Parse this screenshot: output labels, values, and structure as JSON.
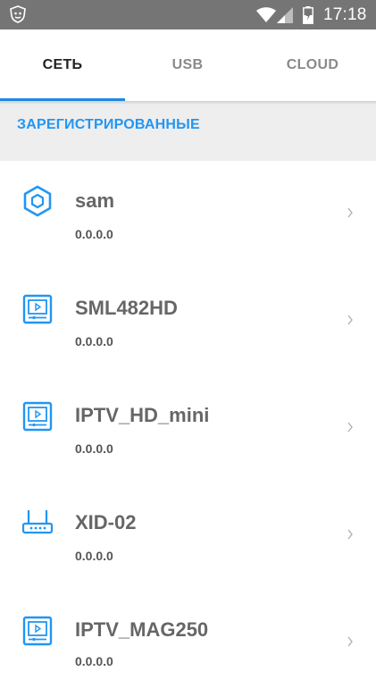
{
  "status_bar": {
    "time": "17:18",
    "icons": [
      "app-shield-icon",
      "wifi-icon",
      "signal-icon",
      "battery-charging-icon"
    ]
  },
  "tabs": [
    {
      "label": "СЕТЬ",
      "active": true
    },
    {
      "label": "USB",
      "active": false
    },
    {
      "label": "CLOUD",
      "active": false
    }
  ],
  "section": {
    "title": "ЗАРЕГИСТРИРОВАННЫЕ"
  },
  "devices": [
    {
      "name": "sam",
      "ip": "0.0.0.0",
      "icon": "hexagon-icon"
    },
    {
      "name": "SML482HD",
      "ip": "0.0.0.0",
      "icon": "tv-player-icon"
    },
    {
      "name": "IPTV_HD_mini",
      "ip": "0.0.0.0",
      "icon": "tv-player-icon"
    },
    {
      "name": "XID-02",
      "ip": "0.0.0.0",
      "icon": "router-icon"
    },
    {
      "name": "IPTV_MAG250",
      "ip": "0.0.0.0",
      "icon": "tv-player-icon"
    }
  ],
  "colors": {
    "accent": "#2196f3",
    "status_bar": "#757575",
    "section_bg": "#eeeeee"
  }
}
